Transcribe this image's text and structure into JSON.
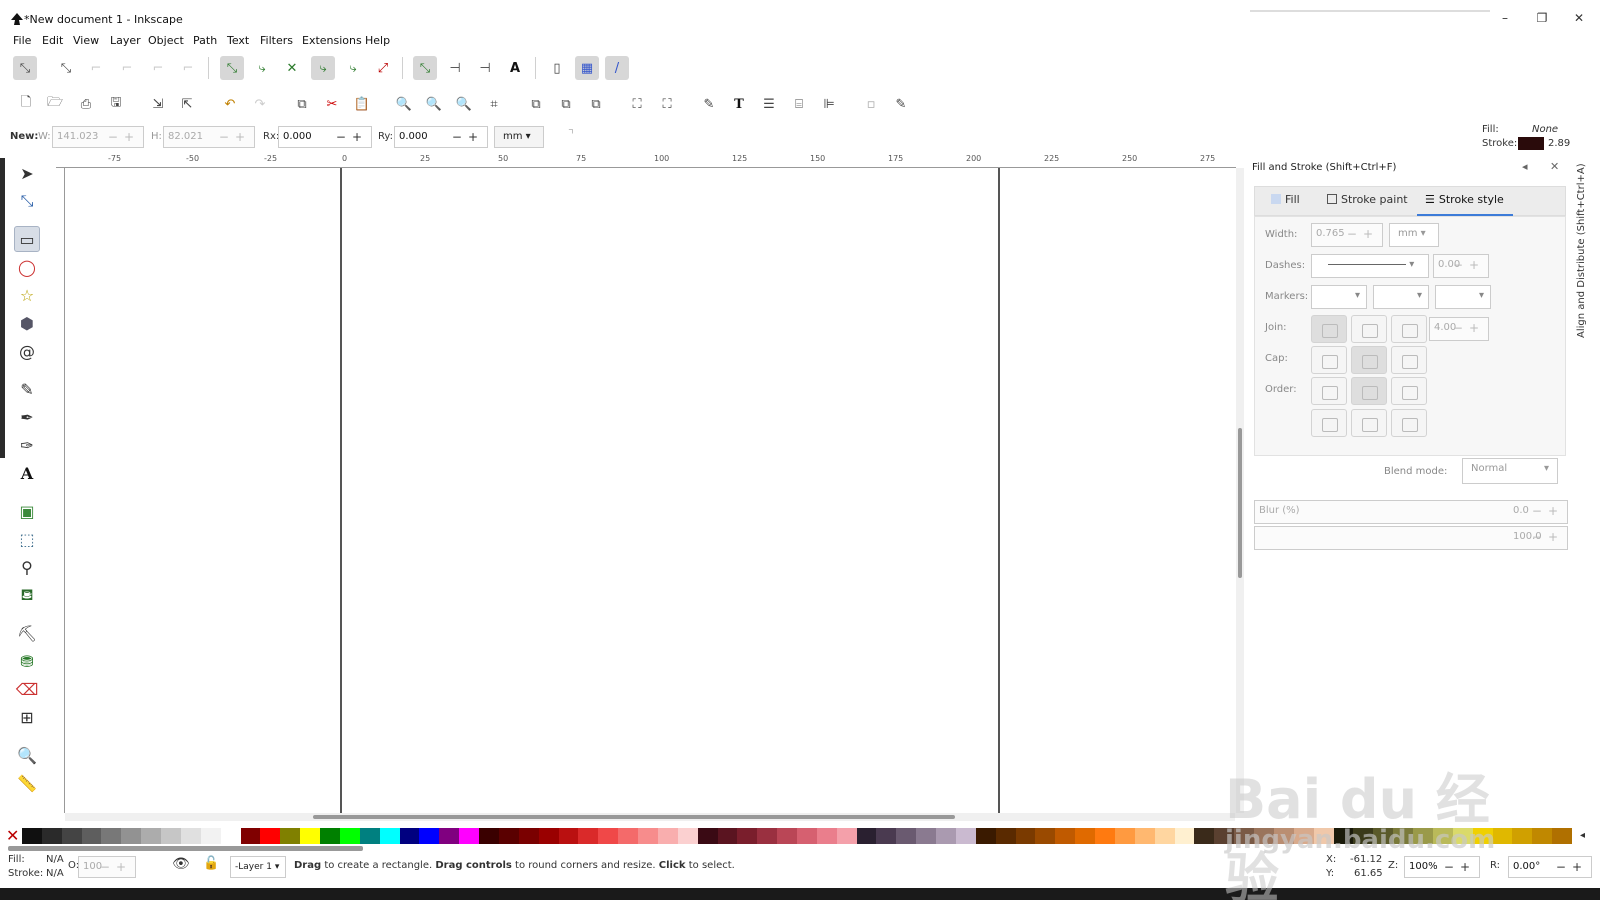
{
  "window": {
    "title": "*New document 1 - Inkscape",
    "minimize": "–",
    "maximize": "❐",
    "close": "✕"
  },
  "menu": [
    "File",
    "Edit",
    "View",
    "Layer",
    "Object",
    "Path",
    "Text",
    "Filters",
    "Extensions",
    "Help"
  ],
  "tool_controls": {
    "new_label": "New:",
    "w_label": "W:",
    "w_value": "141.023",
    "h_label": "H:",
    "h_value": "82.021",
    "rx_label": "Rx:",
    "rx_value": "0.000",
    "ry_label": "Ry:",
    "ry_value": "0.000",
    "unit": "mm"
  },
  "fill_stroke_indicator": {
    "fill_label": "Fill:",
    "fill_value": "None",
    "stroke_label": "Stroke:",
    "stroke_width": "2.89",
    "stroke_color": "#2a0b0b"
  },
  "ruler": {
    "h_ticks": [
      "-75",
      "-50",
      "-25",
      "0",
      "25",
      "50",
      "75",
      "100",
      "125",
      "150",
      "175",
      "200",
      "225",
      "250",
      "275"
    ]
  },
  "dock": {
    "title": "Fill and Stroke (Shift+Ctrl+F)",
    "tabs": [
      "Fill",
      "Stroke paint",
      "Stroke style"
    ],
    "width_label": "Width:",
    "width_value": "0.765",
    "width_unit": "mm",
    "dashes_label": "Dashes:",
    "dashes_value": "0.00",
    "markers_label": "Markers:",
    "join_label": "Join:",
    "join_value": "4.00",
    "cap_label": "Cap:",
    "order_label": "Order:",
    "blend_label": "Blend mode:",
    "blend_value": "Normal",
    "blur_label": "Blur (%)",
    "blur_value": "0.0",
    "opacity_value": "100.0"
  },
  "side_tab": "Align and Distribute (Shift+Ctrl+A)",
  "palette": [
    "#101010",
    "#2a2a2a",
    "#444444",
    "#5e5e5e",
    "#787878",
    "#929292",
    "#acacac",
    "#c6c6c6",
    "#e0e0e0",
    "#f2f2f2",
    "#ffffff",
    "#800000",
    "#ff0000",
    "#808000",
    "#ffff00",
    "#008000",
    "#00ff00",
    "#008080",
    "#00ffff",
    "#000080",
    "#0000ff",
    "#800080",
    "#ff00ff",
    "#3a0000",
    "#5a0000",
    "#7a0000",
    "#9a0000",
    "#ba1010",
    "#da2a2a",
    "#f04848",
    "#f46a6a",
    "#f78c8c",
    "#f9aeae",
    "#fbd0d0",
    "#3a0a14",
    "#5a1420",
    "#7a1e2c",
    "#9a3040",
    "#ba4656",
    "#d66070",
    "#ea7e8c",
    "#f4a0aa",
    "#2a2030",
    "#4a3a50",
    "#6a5a70",
    "#8a7a90",
    "#aa9ab0",
    "#cabad0",
    "#3a1a00",
    "#5a2a00",
    "#7a3a00",
    "#9a4a00",
    "#c05a00",
    "#e06a00",
    "#ff7a10",
    "#ff9a40",
    "#ffb870",
    "#ffd6a0",
    "#fff0d0",
    "#3a2a1a",
    "#5a4030",
    "#7a5a46",
    "#9a745c",
    "#ba8e72",
    "#d8aa8c",
    "#f0c8aa",
    "#1a1a0a",
    "#3a3a1a",
    "#5a5a2a",
    "#7a7a3a",
    "#9a9a4a",
    "#baba5a",
    "#dada6a",
    "#f0d000",
    "#e0b800",
    "#d0a000",
    "#c08800",
    "#b07000"
  ],
  "status": {
    "fill_label": "Fill:",
    "fill_value": "N/A",
    "stroke_label": "Stroke:",
    "stroke_value": "N/A",
    "o_label": "O:",
    "o_value": "100",
    "layer": "-Layer 1",
    "tip_1": "Drag",
    "tip_2": " to create a rectangle. ",
    "tip_3": "Drag controls",
    "tip_4": " to round corners and resize. ",
    "tip_5": "Click",
    "tip_6": " to select.",
    "x_label": "X:",
    "x_value": "-61.12",
    "y_label": "Y:",
    "y_value": "61.65",
    "z_label": "Z:",
    "zoom": "100%",
    "r_label": "R:",
    "rotation": "0.00°"
  },
  "watermark": {
    "line1": "Bai du 经验",
    "line2": "jingyan.baidu.com"
  }
}
